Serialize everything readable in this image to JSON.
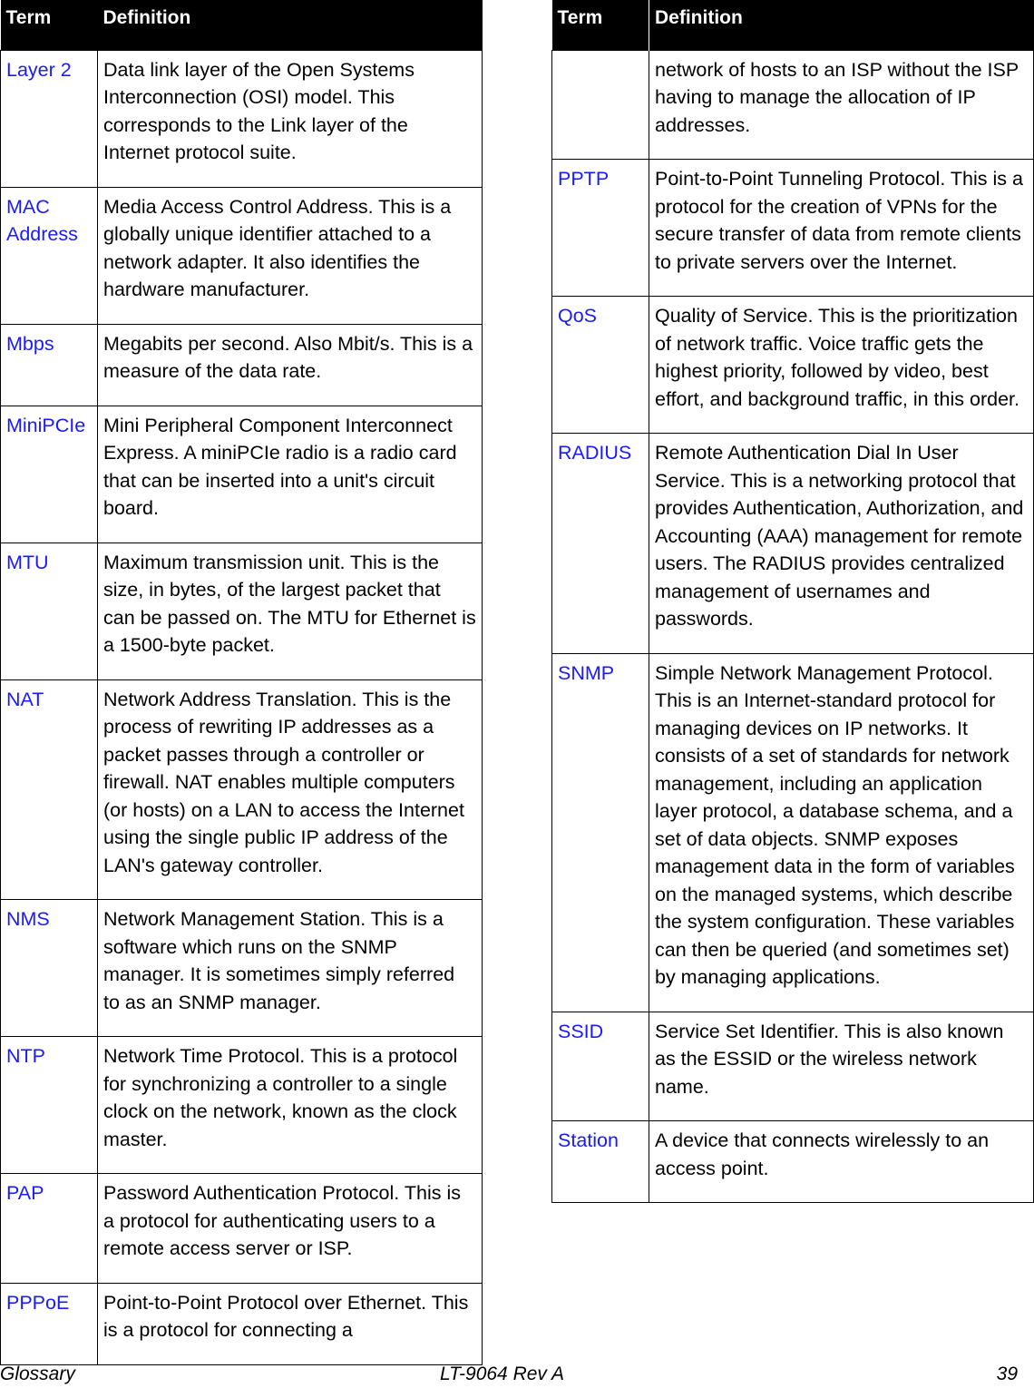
{
  "headers": {
    "term": "Term",
    "definition": "Definition"
  },
  "left_column": [
    {
      "term": "Layer 2",
      "definition": "Data link layer of the Open Systems Interconnection (OSI) model. This corresponds to the Link layer of the Internet protocol suite."
    },
    {
      "term": "MAC Address",
      "definition": "Media Access Control Address. This is a globally unique identifier attached to a network adapter. It also identifies the hardware manufacturer."
    },
    {
      "term": "Mbps",
      "definition": "Megabits per second. Also Mbit/s. This is a measure of the data rate."
    },
    {
      "term": "MiniPCIe",
      "definition": "Mini Peripheral Component Interconnect Express. A miniPCIe radio is a radio card that can be inserted into a unit's circuit board."
    },
    {
      "term": "MTU",
      "definition": "Maximum transmission unit. This is the size, in bytes, of the largest packet that can be passed on. The MTU for Ethernet is a 1500-byte packet."
    },
    {
      "term": "NAT",
      "definition": "Network Address Translation. This is the process of rewriting IP addresses as a packet passes through a controller or firewall. NAT enables multiple computers (or hosts) on a LAN to access the Internet using the single public IP address of the LAN's gateway controller."
    },
    {
      "term": "NMS",
      "definition": "Network Management Station. This is a software which runs on the SNMP manager. It is sometimes simply referred to as an SNMP manager."
    },
    {
      "term": "NTP",
      "definition": "Network Time Protocol. This is a protocol for synchronizing a controller to a single clock on the network, known as the clock master."
    },
    {
      "term": "PAP",
      "definition": "Password Authentication Protocol. This is a protocol for authenticating users to a remote access server or ISP."
    },
    {
      "term": "PPPoE",
      "definition": "Point-to-Point Protocol over Ethernet. This is a protocol for connecting a"
    }
  ],
  "right_column": [
    {
      "term": "",
      "definition": "network of hosts to an ISP without the ISP having to manage the allocation of IP addresses."
    },
    {
      "term": "PPTP",
      "definition": "Point-to-Point Tunneling Protocol. This is a protocol for the creation of VPNs for the secure transfer of data from remote clients to private servers over the Internet."
    },
    {
      "term": "QoS",
      "definition": "Quality of Service. This is the prioritization of network traffic. Voice traffic gets the highest priority, followed by video, best effort, and background traffic, in this order."
    },
    {
      "term": "RADIUS",
      "definition": "Remote Authentication Dial In User Service. This is a networking protocol that provides Authentication, Authorization, and Accounting (AAA) management for remote users. The RADIUS provides centralized management of usernames and passwords."
    },
    {
      "term": "SNMP",
      "definition": "Simple Network Management Protocol. This is an Internet-standard protocol for managing devices on IP networks. It consists of a set of standards for network management, including an application layer protocol, a database schema, and a set of data objects. SNMP exposes management data in the form of variables on the managed systems, which describe the system configuration. These variables can then be queried (and sometimes set) by managing applications."
    },
    {
      "term": "SSID",
      "definition": "Service Set Identifier. This is also known as the ESSID or the wireless network name."
    },
    {
      "term": "Station",
      "definition": "A device that connects wirelessly to an access point."
    }
  ],
  "footer": {
    "section": "Glossary",
    "doc_id": "LT-9064 Rev A",
    "page": "39"
  }
}
